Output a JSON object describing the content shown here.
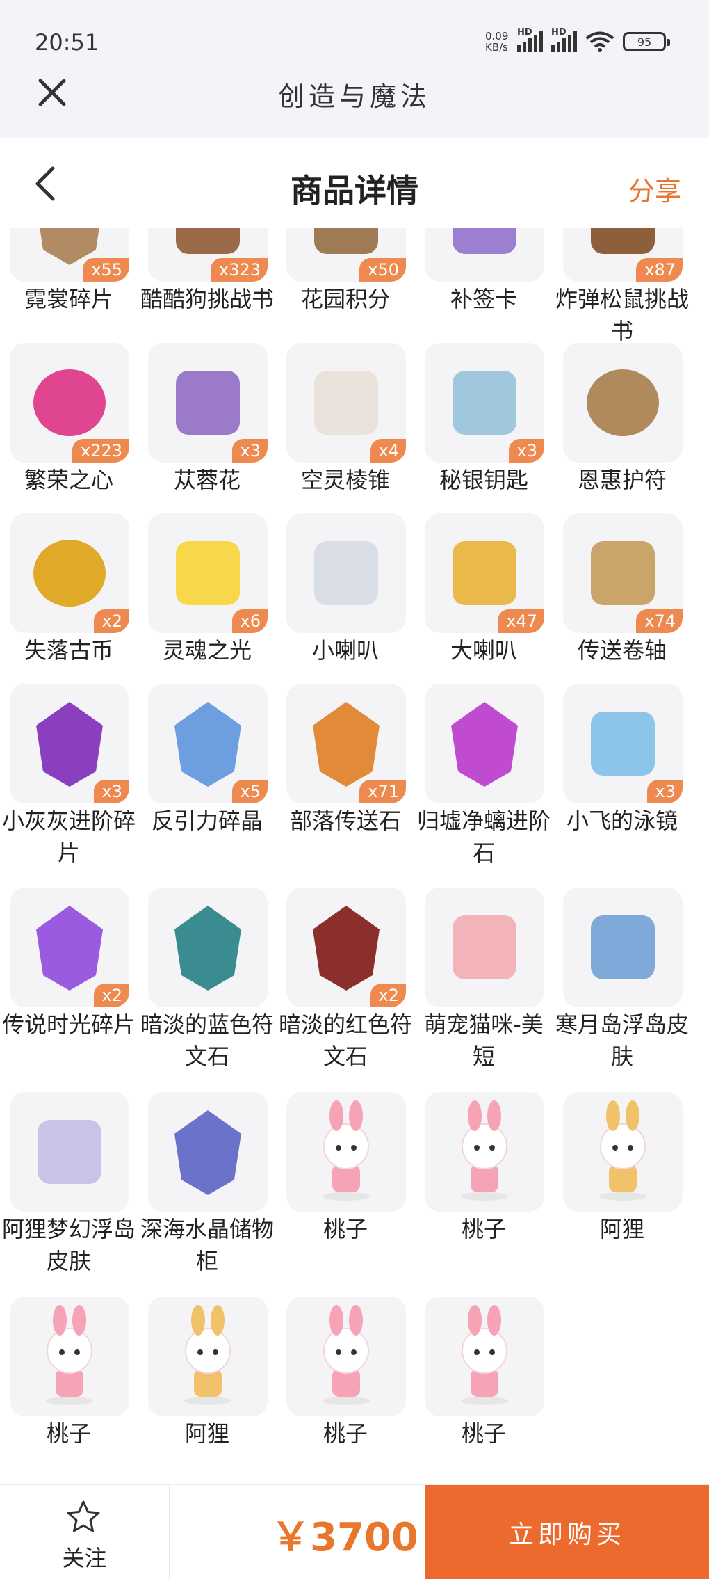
{
  "status_bar": {
    "time": "20:51",
    "net_speed_value": "0.09",
    "net_speed_unit": "KB/s",
    "signal1_tag": "HD",
    "signal2_tag": "HD",
    "battery": "95"
  },
  "app_bar": {
    "title": "创造与魔法"
  },
  "header": {
    "title": "商品详情",
    "share_label": "分享"
  },
  "items": [
    {
      "label": "霓裳碎片",
      "count": "x55",
      "icon": "rainbow-shard-icon",
      "color": "#b28a63"
    },
    {
      "label": "酷酷狗挑战书",
      "count": "x323",
      "icon": "challenge-book-icon",
      "color": "#9b6a48"
    },
    {
      "label": "花园积分",
      "count": "x50",
      "icon": "garden-points-icon",
      "color": "#9f7b55"
    },
    {
      "label": "补签卡",
      "count": "",
      "icon": "makeup-card-icon",
      "color": "#9c7fd1"
    },
    {
      "label": "炸弹松鼠挑战书",
      "count": "x87",
      "icon": "bomb-squirrel-book-icon",
      "color": "#8d5f3b"
    },
    {
      "label": "繁荣之心",
      "count": "x223",
      "icon": "prosperity-heart-icon",
      "color": "#e0458f"
    },
    {
      "label": "苁蓉花",
      "count": "x3",
      "icon": "cistanche-flower-icon",
      "color": "#9b7bc9"
    },
    {
      "label": "空灵棱锥",
      "count": "x4",
      "icon": "ethereal-pyramid-icon",
      "color": "#e9e3dc"
    },
    {
      "label": "秘银钥匙",
      "count": "x3",
      "icon": "mithril-key-icon",
      "color": "#9fc7de"
    },
    {
      "label": "恩惠护符",
      "count": "",
      "icon": "grace-amulet-icon",
      "color": "#b08a5c"
    },
    {
      "label": "失落古币",
      "count": "x2",
      "icon": "ancient-coin-icon",
      "color": "#e1a928"
    },
    {
      "label": "灵魂之光",
      "count": "x6",
      "icon": "soul-light-icon",
      "color": "#f7d84a"
    },
    {
      "label": "小喇叭",
      "count": "",
      "icon": "small-megaphone-icon",
      "color": "#d8dde6"
    },
    {
      "label": "大喇叭",
      "count": "x47",
      "icon": "big-megaphone-icon",
      "color": "#e9b94a"
    },
    {
      "label": "传送卷轴",
      "count": "x74",
      "icon": "teleport-scroll-icon",
      "color": "#c9a56a"
    },
    {
      "label": "小灰灰进阶碎片",
      "count": "x3",
      "icon": "advance-shard-purple-icon",
      "color": "#8a3fbf"
    },
    {
      "label": "反引力碎晶",
      "count": "x5",
      "icon": "antigravity-crystal-icon",
      "color": "#6c9ee0"
    },
    {
      "label": "部落传送石",
      "count": "x71",
      "icon": "tribe-teleport-stone-icon",
      "color": "#e08a3a"
    },
    {
      "label": "归墟净螭进阶石",
      "count": "",
      "icon": "advance-stone-icon",
      "color": "#c04bd0"
    },
    {
      "label": "小飞的泳镜",
      "count": "x3",
      "icon": "swim-goggles-icon",
      "color": "#8cc4ea"
    },
    {
      "label": "传说时光碎片",
      "count": "x2",
      "icon": "time-shard-icon",
      "color": "#9a5be0"
    },
    {
      "label": "暗淡的蓝色符文石",
      "count": "",
      "icon": "blue-rune-stone-icon",
      "color": "#3b8c90"
    },
    {
      "label": "暗淡的红色符文石",
      "count": "x2",
      "icon": "red-rune-stone-icon",
      "color": "#8a2f2a"
    },
    {
      "label": "萌宠猫咪-美短",
      "count": "",
      "icon": "cat-pet-icon",
      "color": "#f2b4b8"
    },
    {
      "label": "寒月岛浮岛皮肤",
      "count": "",
      "icon": "floating-island-ice-icon",
      "color": "#7fa9d8"
    },
    {
      "label": "阿狸梦幻浮岛皮肤",
      "count": "",
      "icon": "floating-island-dream-icon",
      "color": "#c9c3e8"
    },
    {
      "label": "深海水晶储物柜",
      "count": "",
      "icon": "crystal-cabinet-icon",
      "color": "#6a73c9"
    },
    {
      "label": "桃子",
      "count": "",
      "icon": "taozi-character-icon",
      "color": "#f5a3b5"
    },
    {
      "label": "桃子",
      "count": "",
      "icon": "taozi-character-icon",
      "color": "#f5a3b5"
    },
    {
      "label": "阿狸",
      "count": "",
      "icon": "ali-character-icon",
      "color": "#f2c26a"
    },
    {
      "label": "桃子",
      "count": "",
      "icon": "taozi-character-icon",
      "color": "#f5a3b5"
    },
    {
      "label": "阿狸",
      "count": "",
      "icon": "ali-character-icon",
      "color": "#f2c26a"
    },
    {
      "label": "桃子",
      "count": "",
      "icon": "taozi-character-icon",
      "color": "#f5a3b5"
    },
    {
      "label": "桃子",
      "count": "",
      "icon": "taozi-character-icon",
      "color": "#f5a3b5"
    }
  ],
  "bottom_bar": {
    "follow_label": "关注",
    "price": "￥3700",
    "buy_label": "立即购买"
  },
  "colors": {
    "accent": "#e8762d",
    "buy_button": "#ec6a2d",
    "badge": "#ee8a4f"
  }
}
